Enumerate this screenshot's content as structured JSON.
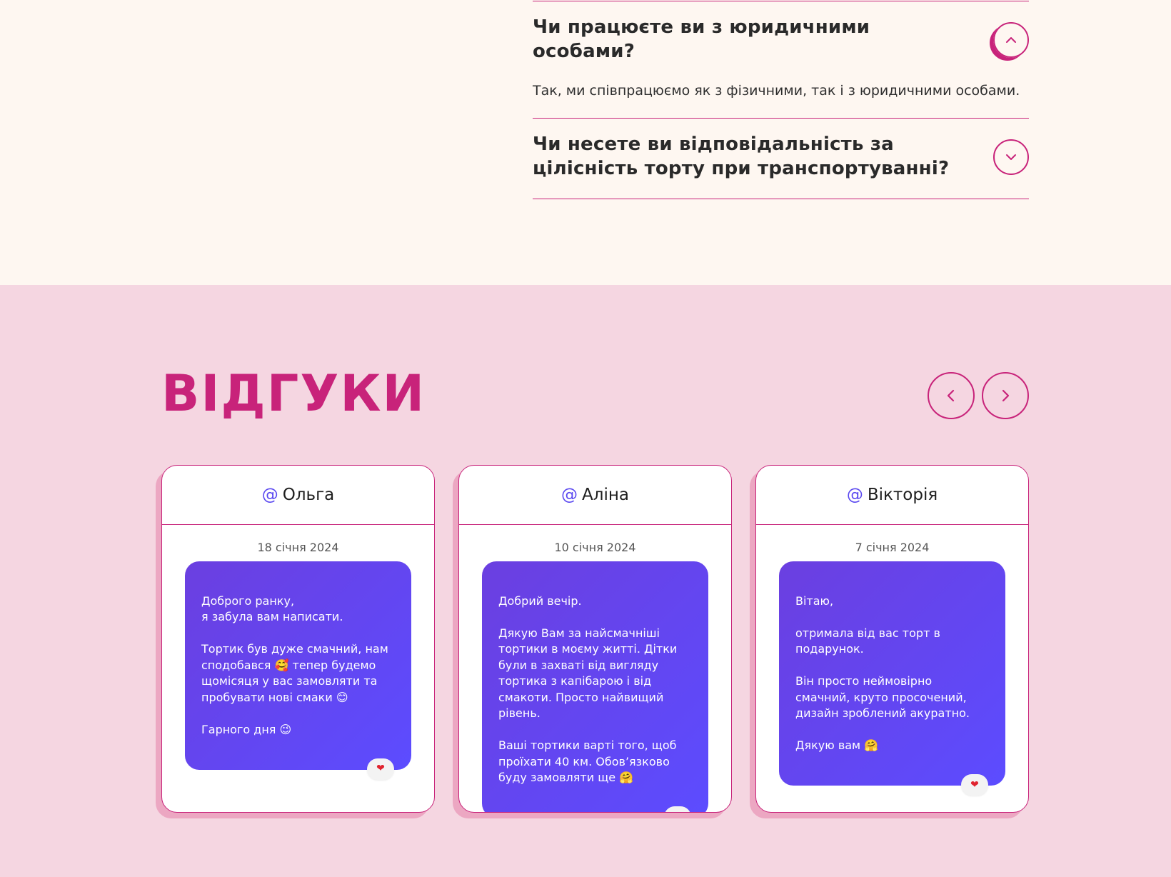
{
  "faq": {
    "items": [
      {
        "question": "Чи працюєте ви з юридичними особами?",
        "answer": "Так, ми співпрацюємо як з фізичними, так і з юридичними особами.",
        "state": "expanded"
      },
      {
        "question": "Чи несете ви відповідальність за цілісність торту при транспортуванні?",
        "state": "collapsed"
      }
    ]
  },
  "reviews": {
    "title": "ВІДГУКИ",
    "prev_icon": "chevron-left-icon",
    "next_icon": "chevron-right-icon",
    "cards": [
      {
        "at": "@",
        "name": "Ольга",
        "date": "18 січня 2024",
        "message": "Доброго ранку,\nя забула вам написати.\n\nТортик був дуже смачний, нам сподобався 🥰 тепер будемо щомісяця у вас замовляти та пробувати нові смаки 😊\n\nГарного дня 😉",
        "reaction": "❤"
      },
      {
        "at": "@",
        "name": "Аліна",
        "date": "10 січня 2024",
        "message": "Добрий вечір.\n\nДякую Вам за найсмачніші тортики в моєму житті. Дітки були в захваті від вигляду тортика з капібарою і від смакоти. Просто найвищий рівень.\n\nВаші тортики варті того, щоб проїхати 40 км. Обов’язково буду замовляти ще 🤗",
        "reaction": "❤"
      },
      {
        "at": "@",
        "name": "Вікторія",
        "date": "7 січня 2024",
        "message": "Вітаю,\n\nотримала від вас торт в подарунок.\n\nВін просто неймовірно смачний, круто просочений, дизайн зроблений акуратно.\n\nДякую вам 🤗",
        "reaction": "❤"
      }
    ]
  },
  "colors": {
    "accent": "#c8237a",
    "faq_bg": "#fef7f1",
    "reviews_bg": "#f5d6e1",
    "bubble_gradient_start": "#6b3fe0",
    "bubble_gradient_end": "#5c4cff"
  }
}
